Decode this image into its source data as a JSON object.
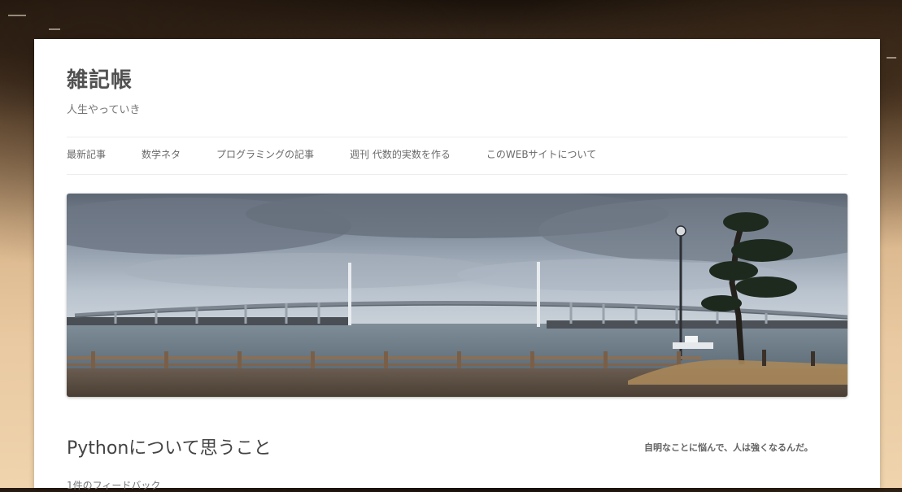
{
  "site": {
    "title": "雑記帳",
    "description": "人生やっていき"
  },
  "nav": {
    "items": [
      {
        "label": "最新記事"
      },
      {
        "label": "数学ネタ"
      },
      {
        "label": "プログラミングの記事"
      },
      {
        "label": "週刊 代数的実数を作る"
      },
      {
        "label": "このWEBサイトについて"
      }
    ]
  },
  "post": {
    "title": "Pythonについて思うこと",
    "comments": "1件のフィードバック"
  },
  "sidebar": {
    "text": "自明なことに悩んで、人は強くなるんだ。"
  }
}
